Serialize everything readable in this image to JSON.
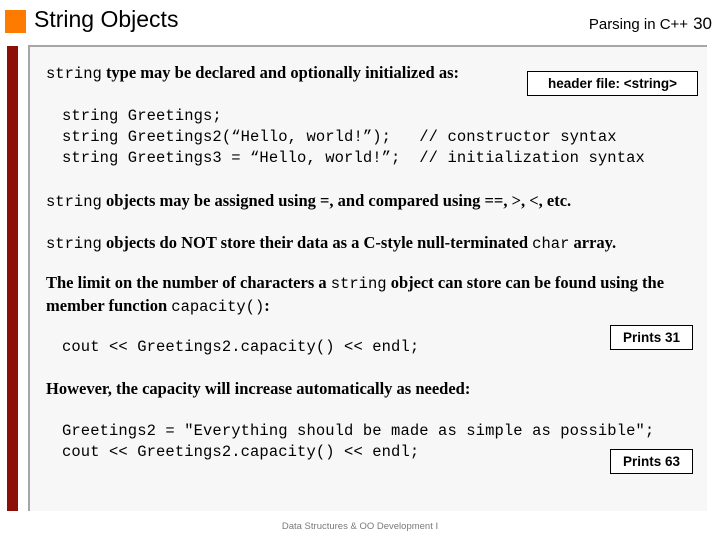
{
  "header": {
    "title": "String Objects",
    "course": "Parsing in C++",
    "page_number": "30",
    "bullet_color": "#FF7B00"
  },
  "accent": {
    "left_bar_color": "#8C1009",
    "panel_bg": "#F7F7F7",
    "panel_border": "#A6A6A6"
  },
  "content": {
    "intro": {
      "code_word": "string",
      "text": " type may be declared and optionally initialized as:"
    },
    "code_block_1": [
      "string Greetings;",
      "string Greetings2(“Hello, world!”);   // constructor syntax",
      "string Greetings3 = “Hello, world!”;  // initialization syntax"
    ],
    "assigned_line": {
      "code_word": "string",
      "text": " objects may be assigned using =, and compared using ==, >, <, etc."
    },
    "storage_line": {
      "code_word": "string",
      "text_before": " objects do NOT store their data as a C-style null-terminated ",
      "code_word_2": "char",
      "text_after": " array."
    },
    "limit_para": {
      "part1": "The limit on the number of characters a ",
      "code1": "string",
      "part2": " object can store can be found using the member function ",
      "code2": "capacity()",
      "part3": ":"
    },
    "code_block_2": [
      "cout << Greetings2.capacity() << endl;"
    ],
    "however_line": "However, the capacity will increase automatically as needed:",
    "code_block_3": [
      "Greetings2 = \"Everything should be made as simple as possible\";",
      "cout << Greetings2.capacity() << endl;"
    ]
  },
  "callouts": {
    "header_file": "header file: <string>",
    "prints_31": "Prints 31",
    "prints_63": "Prints 63"
  },
  "footer": {
    "text": "Data Structures & OO Development I"
  }
}
